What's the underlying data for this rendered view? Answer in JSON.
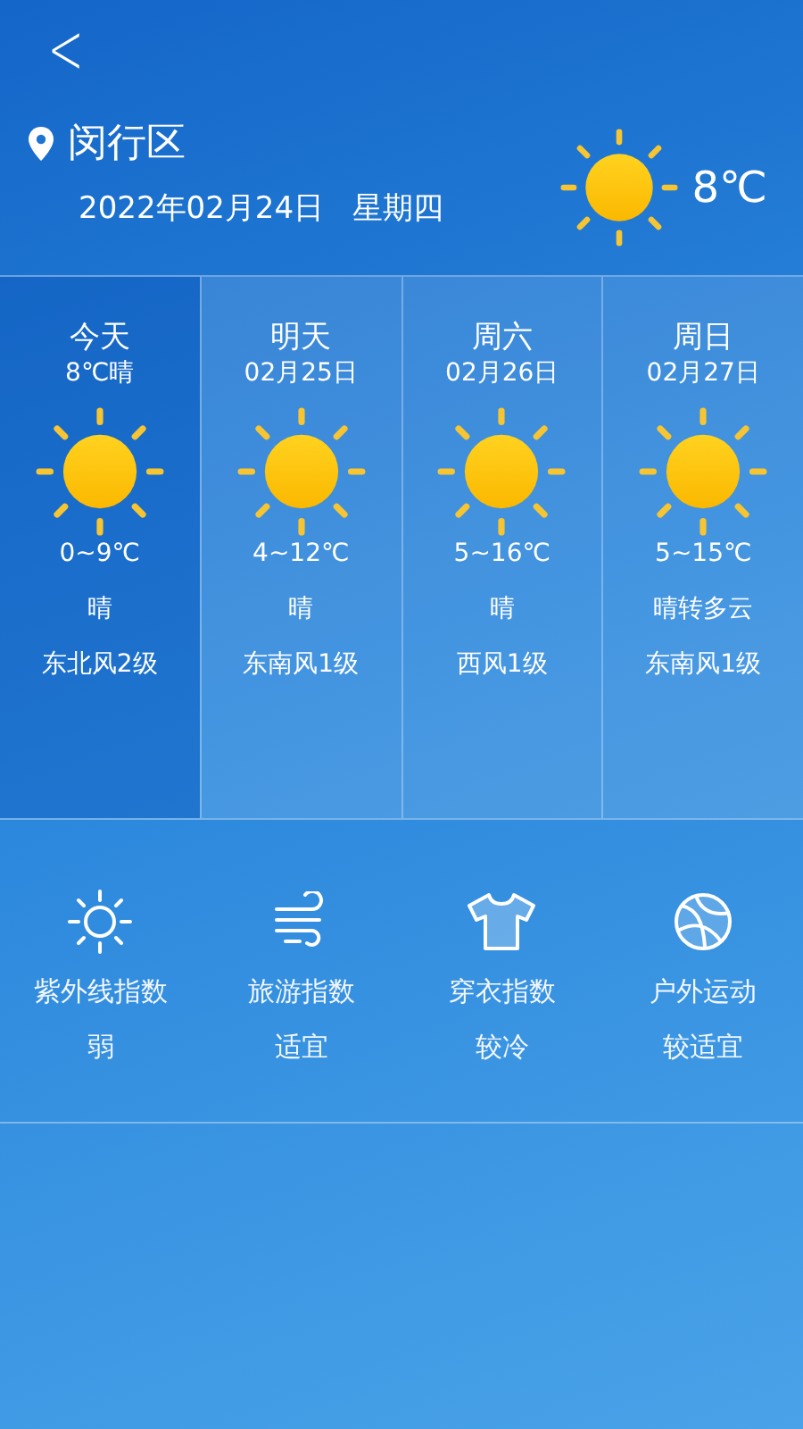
{
  "header": {
    "back": "<",
    "location": "闵行区",
    "date": "2022年02月24日",
    "weekday": "星期四",
    "temperature": "8℃"
  },
  "forecast": [
    {
      "day": "今天",
      "subtitle": "8℃晴",
      "range": "0~9℃",
      "condition": "晴",
      "wind": "东北风2级",
      "selected": true
    },
    {
      "day": "明天",
      "subtitle": "02月25日",
      "range": "4~12℃",
      "condition": "晴",
      "wind": "东南风1级",
      "selected": false
    },
    {
      "day": "周六",
      "subtitle": "02月26日",
      "range": "5~16℃",
      "condition": "晴",
      "wind": "西风1级",
      "selected": false
    },
    {
      "day": "周日",
      "subtitle": "02月27日",
      "range": "5~15℃",
      "condition": "晴转多云",
      "wind": "东南风1级",
      "selected": false
    }
  ],
  "indices": [
    {
      "kind": "uv",
      "name": "紫外线指数",
      "value": "弱"
    },
    {
      "kind": "travel",
      "name": "旅游指数",
      "value": "适宜"
    },
    {
      "kind": "clothing",
      "name": "穿衣指数",
      "value": "较冷"
    },
    {
      "kind": "sport",
      "name": "户外运动",
      "value": "较适宜"
    }
  ]
}
